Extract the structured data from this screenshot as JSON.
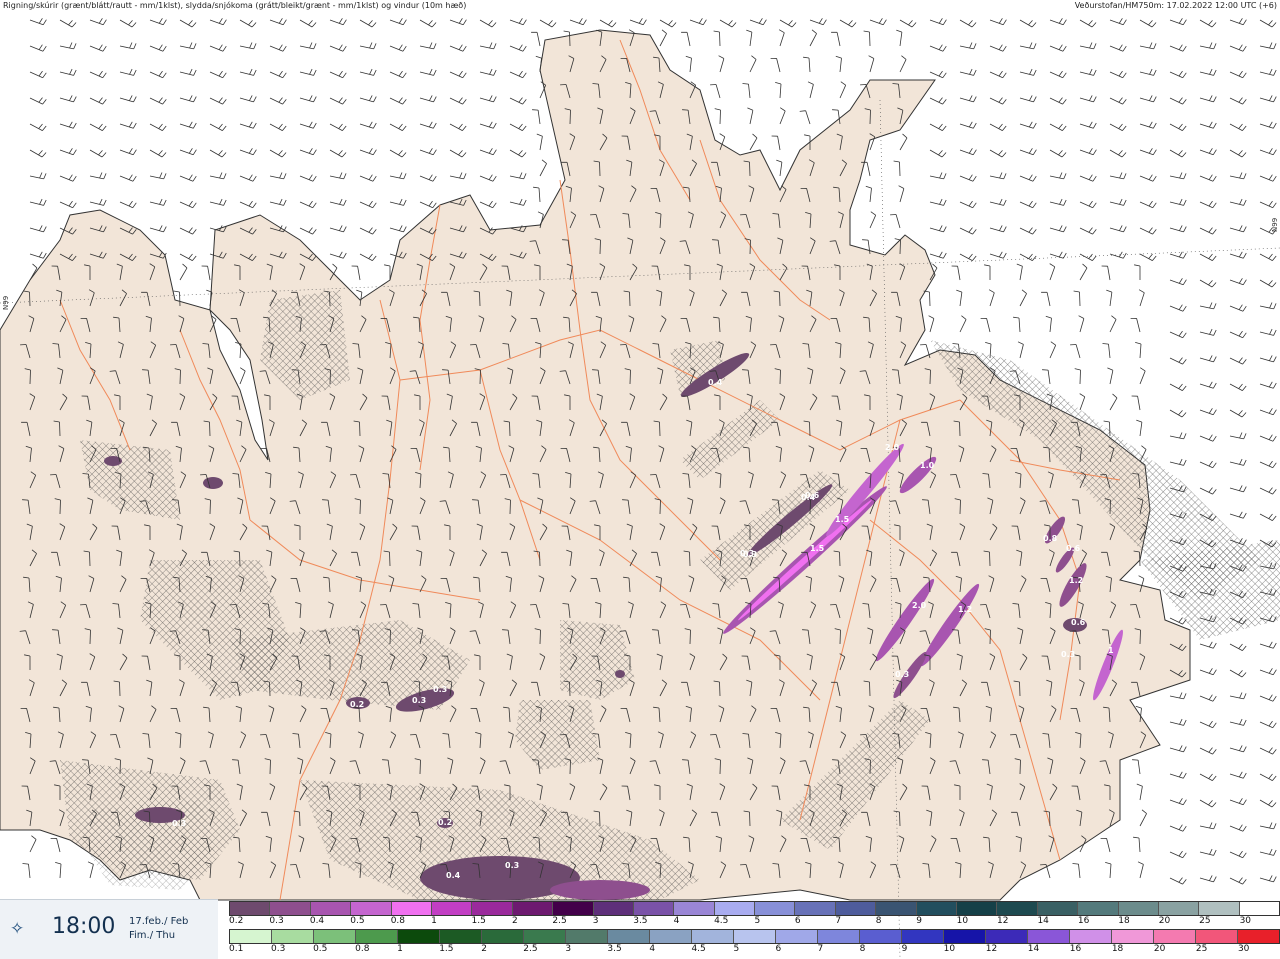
{
  "header": {
    "left": "Rigning/skúrir (grænt/blátt/rautt - mm/1klst), slydda/snjókoma (grátt/bleikt/grænt - mm/1klst) og vindur (10m hæð)",
    "right": "Veðurstofan/HM750m: 17.02.2022 12:00 UTC (+6)"
  },
  "grid_label": "N99",
  "time": {
    "icon": "compass-star-icon",
    "value": "18:00",
    "date_line1": "17.feb./ Feb",
    "date_line2": "Fim./ Thu"
  },
  "legend_top": {
    "labels": [
      "0.2",
      "0.3",
      "0.4",
      "0.5",
      "0.8",
      "1",
      "1.5",
      "2",
      "2.5",
      "3",
      "3.5",
      "4",
      "4.5",
      "5",
      "6",
      "7",
      "8",
      "9",
      "10",
      "12",
      "14",
      "16",
      "18",
      "20",
      "25",
      "30"
    ],
    "colors": [
      "#6e4a6e",
      "#8e4f8e",
      "#a855b0",
      "#c465cf",
      "#f070f0",
      "#c23ec4",
      "#9a2a9c",
      "#6d1a70",
      "#43004a",
      "#5e2f7a",
      "#7a52a8",
      "#9a86d6",
      "#a9acf0",
      "#8890d8",
      "#6872b8",
      "#4e5c9c",
      "#3a5472",
      "#224e5e",
      "#154048",
      "#1e4a50",
      "#3a6064",
      "#547a7c",
      "#6c8c8c",
      "#8aa2a2",
      "#b0c0c0",
      "#ffffff"
    ]
  },
  "legend_bottom": {
    "labels": [
      "0.1",
      "0.3",
      "0.5",
      "0.8",
      "1",
      "1.5",
      "2",
      "2.5",
      "3",
      "3.5",
      "4",
      "4.5",
      "5",
      "6",
      "7",
      "8",
      "9",
      "10",
      "12",
      "14",
      "16",
      "18",
      "20",
      "25",
      "30"
    ],
    "colors": [
      "#d6f5d0",
      "#a8dca0",
      "#7cc07a",
      "#4d9a4d",
      "#0c4a0c",
      "#1c5a24",
      "#2a6a3a",
      "#3a7a4e",
      "#527a6a",
      "#6a8aa0",
      "#8aa2c2",
      "#a2b4dc",
      "#b8c4ee",
      "#a0a8e8",
      "#7e86dc",
      "#5a5ed0",
      "#3236c0",
      "#1614a8",
      "#3c2ab8",
      "#8a56d8",
      "#d090e8",
      "#f098d8",
      "#f47ab0",
      "#f2567a",
      "#e8202a"
    ]
  },
  "labels": [
    {
      "text": "0.4"
    },
    {
      "text": "0.3"
    },
    {
      "text": "0.4"
    },
    {
      "text": "0.6"
    },
    {
      "text": "0.3"
    },
    {
      "text": "1.5"
    },
    {
      "text": "1.5"
    },
    {
      "text": "2.0"
    },
    {
      "text": "1.0"
    },
    {
      "text": "2.0"
    },
    {
      "text": "1.2"
    },
    {
      "text": "0.3"
    },
    {
      "text": "0.8"
    },
    {
      "text": "0.6"
    },
    {
      "text": "1.2"
    },
    {
      "text": "0.6"
    },
    {
      "text": "0.3"
    },
    {
      "text": "0.3"
    },
    {
      "text": "0.2"
    },
    {
      "text": "0.3"
    },
    {
      "text": "0.4"
    },
    {
      "text": "0.3"
    },
    {
      "text": "0.3"
    },
    {
      "text": "0.2"
    },
    {
      "text": "1"
    }
  ],
  "colors": {
    "land": "#f2e5d8",
    "sea": "#ffffff",
    "roads": "#f08a5a",
    "coast": "#3a3a3a",
    "snow_hatch": "#444444",
    "precip_purple": "#8a3f8a"
  }
}
